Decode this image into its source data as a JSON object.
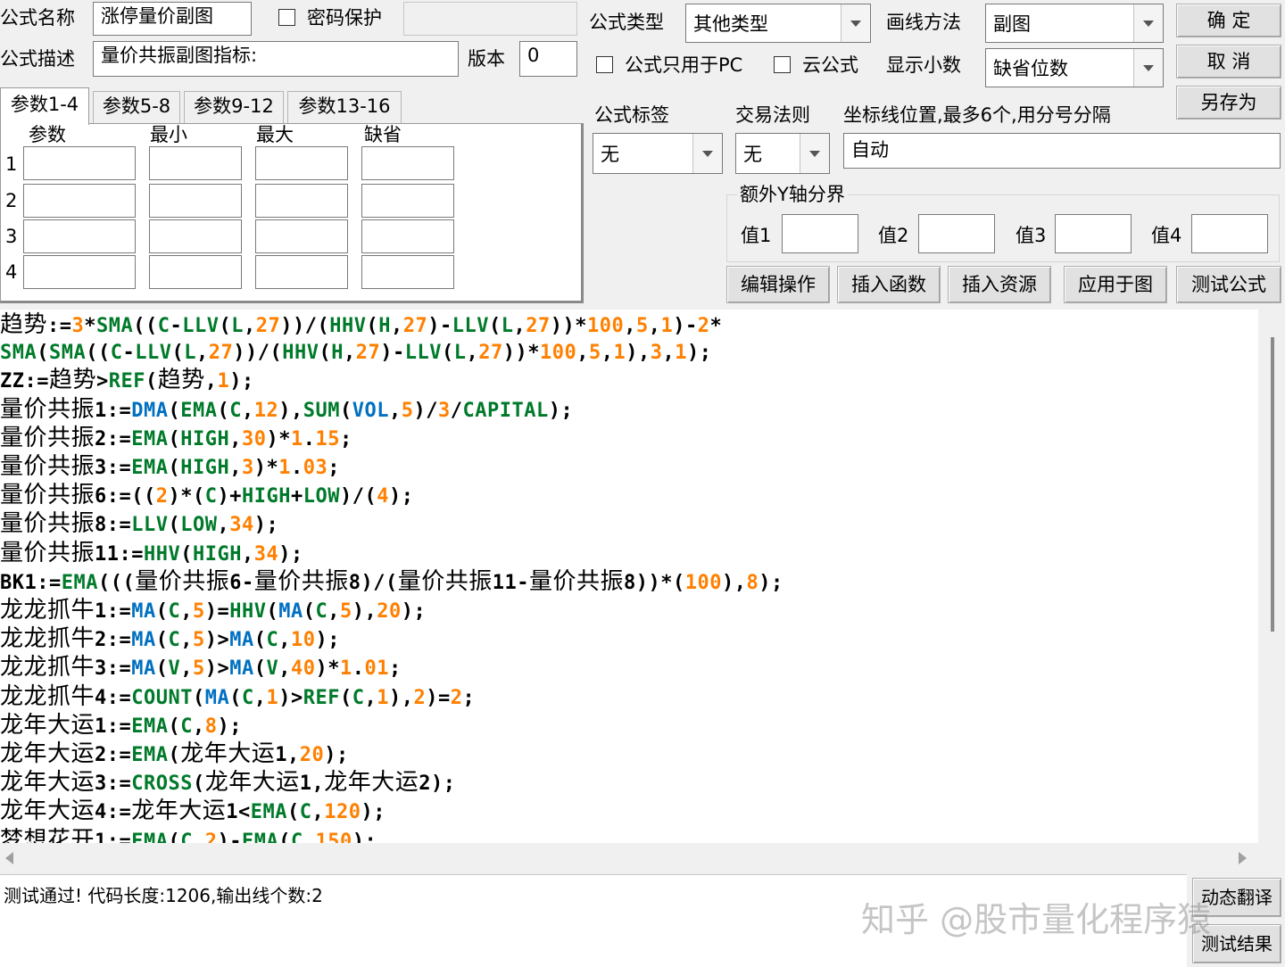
{
  "form": {
    "name_label": "公式名称",
    "name_value": "涨停量价副图",
    "password_label": "密码保护",
    "desc_label": "公式描述",
    "desc_value": "量价共振副图指标:",
    "version_label": "版本",
    "version_value": "0",
    "type_label": "公式类型",
    "type_value": "其他类型",
    "draw_label": "画线方法",
    "draw_value": "副图",
    "pc_only_label": "公式只用于PC",
    "cloud_label": "云公式",
    "decimal_label": "显示小数",
    "decimal_value": "缺省位数",
    "tag_label": "公式标签",
    "tag_value": "无",
    "trade_label": "交易法则",
    "trade_value": "无",
    "axis_label": "坐标线位置,最多6个,用分号分隔",
    "axis_value": "自动",
    "yaxis_group": "额外Y轴分界",
    "yaxis_v1": "值1",
    "yaxis_v2": "值2",
    "yaxis_v3": "值3",
    "yaxis_v4": "值4"
  },
  "buttons": {
    "ok": "确 定",
    "cancel": "取 消",
    "save_as": "另存为",
    "edit_ops": "编辑操作",
    "insert_func": "插入函数",
    "insert_res": "插入资源",
    "apply_chart": "应用于图",
    "test_formula": "测试公式",
    "dyn_translate": "动态翻译",
    "test_result": "测试结果"
  },
  "tabs": [
    "参数1-4",
    "参数5-8",
    "参数9-12",
    "参数13-16"
  ],
  "params": {
    "headers": [
      "参数",
      "最小",
      "最大",
      "缺省"
    ],
    "rows": [
      "1",
      "2",
      "3",
      "4"
    ]
  },
  "status": {
    "text": "测试通过! 代码长度:1206,输出线个数:2"
  },
  "watermark": "知乎 @股市量化程序猿",
  "colors": {
    "function": "#007a2a",
    "builtin": "#0070c0",
    "number": "#ff8000"
  }
}
